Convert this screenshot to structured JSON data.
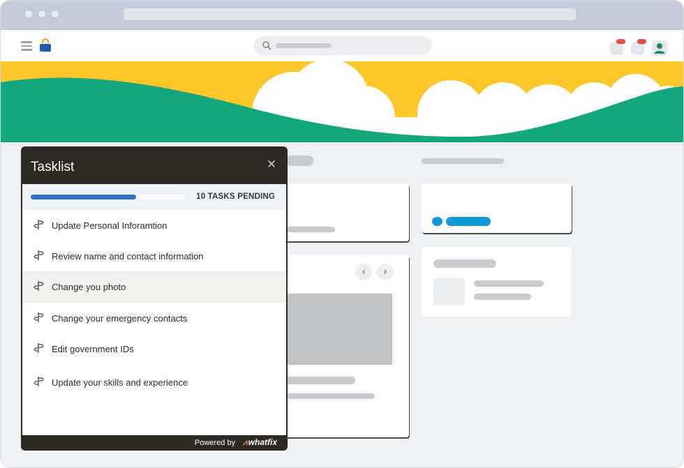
{
  "chrome": {
    "window_dots": 3
  },
  "header": {
    "menu_icon": "hamburger-icon",
    "logo_icon": "briefcase-logo-icon",
    "search_icon": "search-icon",
    "notification_buttons": 2,
    "avatar_icon": "user-icon"
  },
  "colors": {
    "banner_yellow": "#ffc72a",
    "banner_green": "#13a77c",
    "progress_blue": "#2f74c0",
    "accent_blue": "#0e9bd8",
    "badge_red": "#e64b4f",
    "panel_dark": "#2d2a24",
    "brand_orange": "#f28c38"
  },
  "tasklist": {
    "title": "Tasklist",
    "close_icon": "close-icon",
    "progress_fraction": 0.68,
    "pending_label": "10 TASKS PENDING",
    "tasks": [
      {
        "label": "Update Personal Inforamtion",
        "icon": "signpost-icon"
      },
      {
        "label": "Review name and contact information",
        "icon": "signpost-icon"
      },
      {
        "label": "Change you photo",
        "icon": "signpost-icon",
        "highlighted": true
      },
      {
        "label": "Change your emergency contacts",
        "icon": "signpost-icon"
      },
      {
        "label": "Edit government IDs",
        "icon": "signpost-icon"
      },
      {
        "label": "Update your skills and experience",
        "icon": "signpost-icon"
      }
    ],
    "footer": {
      "powered_by": "Powered by",
      "brand": "whatfix"
    }
  },
  "carousel": {
    "prev_icon": "chevron-left-icon",
    "next_icon": "chevron-right-icon"
  }
}
